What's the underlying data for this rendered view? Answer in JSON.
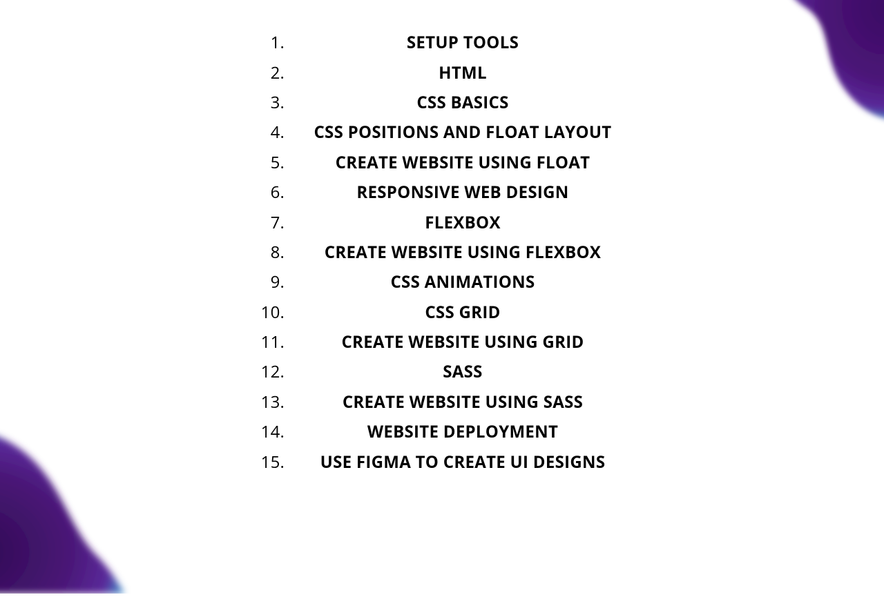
{
  "items": [
    {
      "n": "1.",
      "label": "SETUP TOOLS"
    },
    {
      "n": "2.",
      "label": "HTML"
    },
    {
      "n": "3.",
      "label": "CSS BASICS"
    },
    {
      "n": "4.",
      "label": "CSS POSITIONS AND FLOAT LAYOUT"
    },
    {
      "n": "5.",
      "label": "CREATE  WEBSITE USING FLOAT"
    },
    {
      "n": "6.",
      "label": "RESPONSIVE WEB DESIGN"
    },
    {
      "n": "7.",
      "label": "FLEXBOX"
    },
    {
      "n": "8.",
      "label": "CREATE WEBSITE USING FLEXBOX"
    },
    {
      "n": "9.",
      "label": "CSS ANIMATIONS"
    },
    {
      "n": "10.",
      "label": "CSS GRID"
    },
    {
      "n": "11.",
      "label": "CREATE WEBSITE USING GRID"
    },
    {
      "n": "12.",
      "label": "SASS"
    },
    {
      "n": "13.",
      "label": "CREATE WEBSITE USING SASS"
    },
    {
      "n": "14.",
      "label": "WEBSITE DEPLOYMENT"
    },
    {
      "n": "15.",
      "label": "USE FIGMA TO CREATE UI DESIGNS"
    }
  ]
}
